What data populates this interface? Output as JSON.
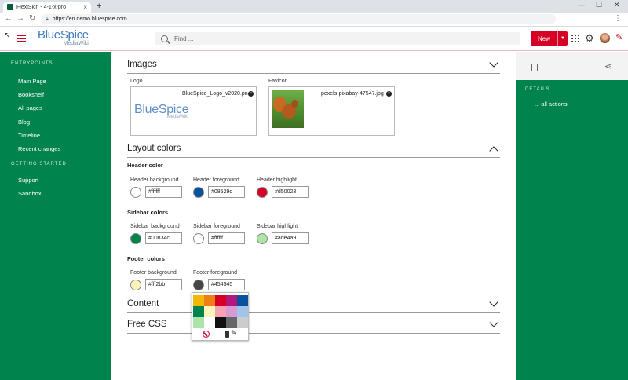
{
  "browser": {
    "tab_title": "FlexiSkin - 4-1-x-pro",
    "tab_close": "×",
    "new_tab": "+",
    "url": "https://en.demo.bluespice.com",
    "back": "←",
    "forward": "→",
    "reload": "↻",
    "minimize": "—",
    "maximize": "☐",
    "close": "✕",
    "menu": "⋮"
  },
  "header": {
    "logo_main": "BlueSpice",
    "logo_sub": "MediaWiki",
    "search_placeholder": "Find ...",
    "new_label": "New",
    "new_dropdown": "▼",
    "gear": "⚙",
    "pin": "✎",
    "accent_color": "#d50023"
  },
  "sidebar": {
    "sections": [
      {
        "label": "ENTRYPOINTS",
        "items": [
          "Main Page",
          "Bookshelf",
          "All pages",
          "Blog",
          "Timeline",
          "Recent changes"
        ]
      },
      {
        "label": "GETTING STARTED",
        "items": [
          "Support",
          "Sandbox"
        ]
      }
    ]
  },
  "main": {
    "images": {
      "title": "Images",
      "logo_label": "Logo",
      "logo_file": "BlueSpice_Logo_v2020.pn",
      "logo_preview_main": "BlueSpice",
      "logo_preview_sub": "MediaWiki",
      "favicon_label": "Favicon",
      "favicon_file": "pexels-pixabay-47547.jpg",
      "remove": "×"
    },
    "layout_colors": {
      "title": "Layout colors",
      "header": {
        "heading": "Header color",
        "fields": [
          {
            "label": "Header background",
            "value": "#ffffff",
            "color": "#ffffff"
          },
          {
            "label": "Header foreground",
            "value": "#08529d",
            "color": "#08529d"
          },
          {
            "label": "Header highlight",
            "value": "#d50023",
            "color": "#d50023"
          }
        ]
      },
      "sidebar": {
        "heading": "Sidebar colors",
        "fields": [
          {
            "label": "Sidebar background",
            "value": "#00834c",
            "color": "#00834c"
          },
          {
            "label": "Sidebar foreground",
            "value": "#ffffff",
            "color": "#ffffff"
          },
          {
            "label": "Sidebar highlight",
            "value": "#ade4a9",
            "color": "#ade4a9"
          }
        ]
      },
      "footer": {
        "heading": "Footer colors",
        "fields": [
          {
            "label": "Footer background",
            "value": "#fff2bb",
            "color": "#fff2bb"
          },
          {
            "label": "Footer foreground",
            "value": "#454545",
            "color": "#454545"
          }
        ]
      }
    },
    "content": {
      "title": "Content"
    },
    "free_css": {
      "title": "Free CSS"
    }
  },
  "picker": {
    "palette": [
      "#f5b800",
      "#ef7d1a",
      "#d50023",
      "#b0187e",
      "#08529d",
      "#00834c",
      "#fff2bb",
      "#f5a3b3",
      "#d79ad3",
      "#9ec4ea",
      "#ade4a9",
      "#ffffff",
      "#111111",
      "#666666",
      "#cccccc"
    ],
    "edit_icon": "✎"
  },
  "right_panel": {
    "details_label": "DETAILS",
    "actions_link": "... all actions",
    "share_icon": "⋖"
  }
}
